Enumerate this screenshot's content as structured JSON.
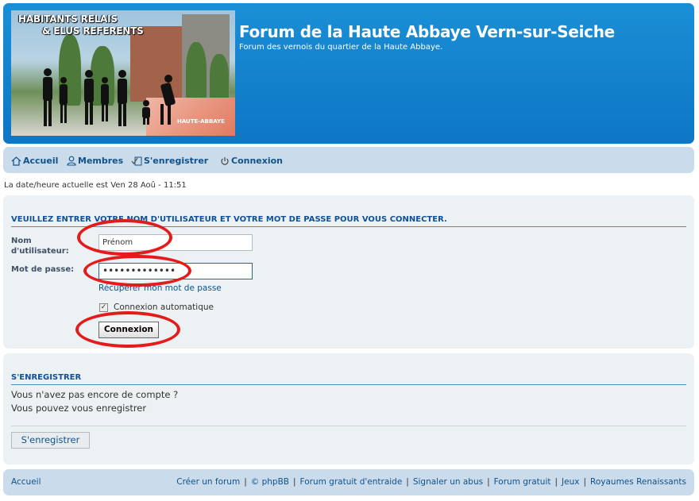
{
  "header": {
    "banner_title_line1": "HABITANTS RELAIS",
    "banner_title_line2": "& ELUS REFERENTS",
    "banner_stamp": "HAUTE-ABBAYE",
    "site_title": "Forum de la Haute Abbaye Vern-sur-Seiche",
    "site_description": "Forum des vernois du quartier de la Haute Abbaye."
  },
  "nav": {
    "items": [
      {
        "label": "Accueil",
        "icon": "home-icon"
      },
      {
        "label": "Membres",
        "icon": "user-icon"
      },
      {
        "label": "S'enregistrer",
        "icon": "register-icon"
      },
      {
        "label": "Connexion",
        "icon": "power-icon"
      }
    ]
  },
  "date_line": "La date/heure actuelle est Ven 28 Aoû - 11:51",
  "login": {
    "heading": "Veuillez entrer votre nom d'utilisateur et votre mot de passe pour vous connecter.",
    "username_label_line1": "Nom",
    "username_label_line2": "d'utilisateur:",
    "username_value": "Prénom",
    "password_label": "Mot de passe:",
    "password_value": "•••••••••••••",
    "forgot_link": "Récupérer mon mot de passe",
    "auto_login_label": "Connexion automatique",
    "auto_login_checked": true,
    "submit_label": "Connexion"
  },
  "register": {
    "heading": "S'enregistrer",
    "line1": "Vous n'avez pas encore de compte ?",
    "line2": "Vous pouvez vous enregistrer",
    "button_label": "S'enregistrer"
  },
  "footer": {
    "home_link": "Accueil",
    "links": [
      "Créer un forum",
      "© phpBB",
      "Forum gratuit d'entraide",
      "Signaler un abus",
      "Forum gratuit",
      "Jeux",
      "Royaumes Renaissants"
    ]
  },
  "colors": {
    "header_bg": "#0d76c5",
    "nav_bg": "#cadceb",
    "panel_bg": "#ecf1f3",
    "link": "#105289",
    "annotation": "#e51a1a"
  }
}
